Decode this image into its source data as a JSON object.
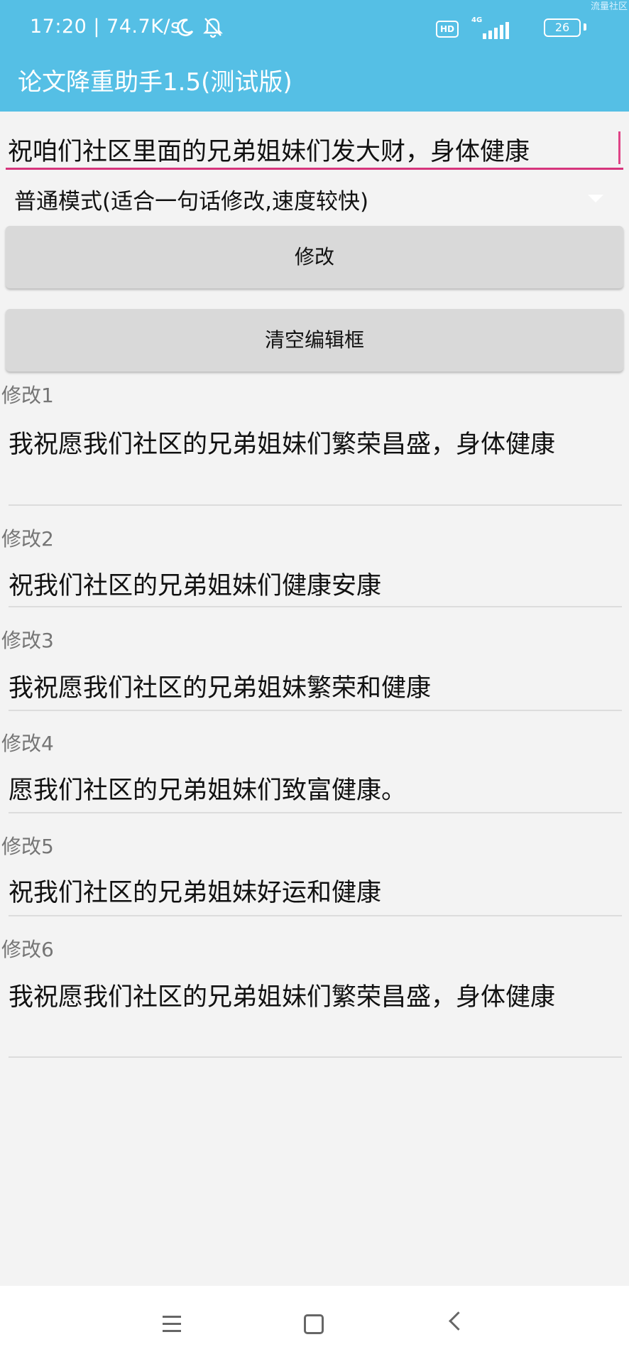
{
  "status_bar": {
    "time_speed": "17:20 | 74.7K/s",
    "hd": "HD",
    "network": "4G",
    "battery": "26",
    "corner_mark": "流量社区"
  },
  "app": {
    "title": "论文降重助手1.5(测试版)"
  },
  "input": {
    "value": "祝咱们社区里面的兄弟姐妹们发大财，身体健康"
  },
  "mode": {
    "selected": "普通模式(适合一句话修改,速度较快)"
  },
  "buttons": {
    "modify": "修改",
    "clear": "清空编辑框"
  },
  "results": [
    {
      "label": "修改1",
      "text": "我祝愿我们社区的兄弟姐妹们繁荣昌盛，身体健康"
    },
    {
      "label": "修改2",
      "text": "祝我们社区的兄弟姐妹们健康安康"
    },
    {
      "label": "修改3",
      "text": "我祝愿我们社区的兄弟姐妹繁荣和健康"
    },
    {
      "label": "修改4",
      "text": "愿我们社区的兄弟姐妹们致富健康。"
    },
    {
      "label": "修改5",
      "text": "祝我们社区的兄弟姐妹好运和健康"
    },
    {
      "label": "修改6",
      "text": "我祝愿我们社区的兄弟姐妹们繁荣昌盛，身体健康"
    }
  ],
  "icons": {
    "moon": "moon-icon",
    "mute": "bell-off-icon",
    "signal": "signal-icon",
    "battery": "battery-icon",
    "dropdown": "dropdown-arrow-icon",
    "nav_menu": "menu-icon",
    "nav_home": "home-icon",
    "nav_back": "back-icon"
  },
  "colors": {
    "header": "#55bfe5",
    "accent": "#d6357c",
    "button": "#d9d9d9",
    "background": "#f3f3f3"
  }
}
